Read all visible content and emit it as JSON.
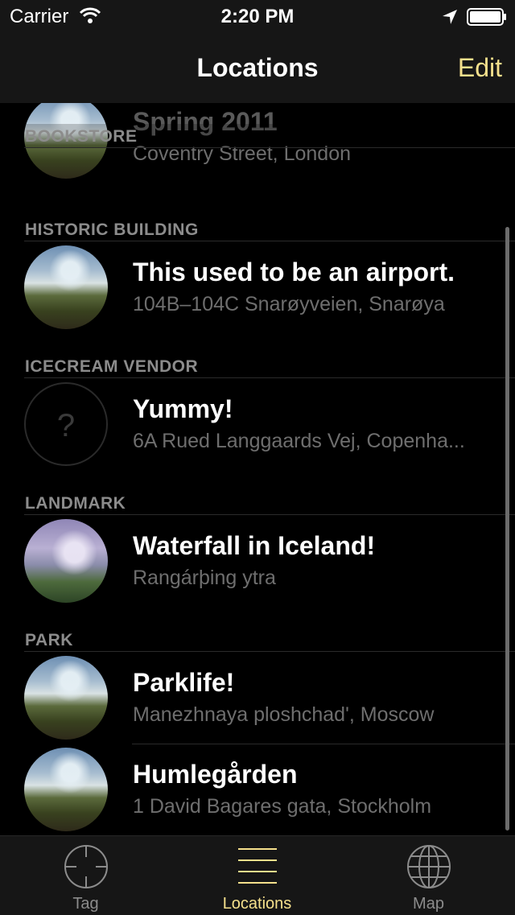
{
  "status_bar": {
    "carrier": "Carrier",
    "time": "2:20 PM"
  },
  "nav": {
    "title": "Locations",
    "edit_label": "Edit"
  },
  "sections": [
    {
      "header": "BOOKSTORE",
      "rows": [
        {
          "title": "Spring 2011",
          "address": "Coventry Street, London",
          "image": "photo"
        }
      ]
    },
    {
      "header": "HISTORIC BUILDING",
      "rows": [
        {
          "title": "This used to be an airport.",
          "address": "104B–104C Snarøyveien, Snarøya",
          "image": "photo"
        }
      ]
    },
    {
      "header": "ICECREAM VENDOR",
      "rows": [
        {
          "title": "Yummy!",
          "address": "6A Rued Langgaards Vej, Copenha...",
          "image": "placeholder",
          "placeholder_glyph": "?"
        }
      ]
    },
    {
      "header": "LANDMARK",
      "rows": [
        {
          "title": "Waterfall in Iceland!",
          "address": "Rangárþing ytra",
          "image": "photo"
        }
      ]
    },
    {
      "header": "PARK",
      "rows": [
        {
          "title": "Parklife!",
          "address": "Manezhnaya ploshchad', Moscow",
          "image": "photo"
        },
        {
          "title": "Humlegården",
          "address": "1 David Bagares gata, Stockholm",
          "image": "photo"
        }
      ]
    }
  ],
  "tabs": [
    {
      "label": "Tag",
      "icon": "crosshair-icon",
      "active": false
    },
    {
      "label": "Locations",
      "icon": "list-icon",
      "active": true
    },
    {
      "label": "Map",
      "icon": "globe-icon",
      "active": false
    }
  ],
  "colors": {
    "accent": "#f5e08c",
    "background": "#000000",
    "bar": "#161616",
    "secondary_text": "#6e6e6e",
    "header_text": "#8c8c8c"
  }
}
